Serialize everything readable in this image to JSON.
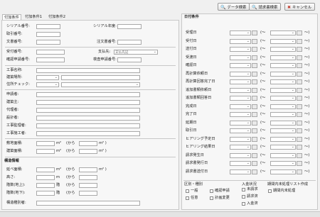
{
  "toolbar": {
    "data_search": "データ検索",
    "request_search": "請求書検索",
    "cancel": "キャンセル"
  },
  "tabs": [
    "付加条件",
    "付加条件1",
    "付加条件2"
  ],
  "left": {
    "serial_no": "シリアル番号:",
    "serial_ver": "シリアル年度:",
    "request_no": "取引番号:",
    "doc_no": "文書番号:",
    "contract_no": "注文書番号:",
    "accept_no": "受付番号:",
    "payment_to": "支払先:",
    "payment_to_placeholder": "支払先記",
    "confirm_no": "確認申請番号:",
    "check_confirm_no": "検査申請番号:",
    "work_name": "工事名称:",
    "building_place": "建築場所:",
    "address_check": "住所チェック:",
    "applicant": "申請者:",
    "builder": "建築主:",
    "agent": "代理者:",
    "designer": "設計者:",
    "supervisor": "工事監理者:",
    "contractor": "工事施工者:",
    "floor_area": "敷地面積:",
    "building_area": "建築面積:",
    "unit_m2": "m²",
    "from": "(から",
    "to_unit": "m²  )",
    "section_building": "構造情報",
    "total_floor": "延べ面積:",
    "height": "高さ:",
    "floors_above": "階数(地上):",
    "floors_below": "階数(地下):",
    "unit_m": "m",
    "unit_floor": "階",
    "remarks": "構造種別者:"
  },
  "right": {
    "section_date": "日付条件",
    "date_rows": [
      "受理日",
      "受付日",
      "送付日",
      "受渡日",
      "確認日",
      "再計算依頼日",
      "再計算回答完了日",
      "追加書類依頼日",
      "追加書類回答日",
      "完成日",
      "完了日",
      "延期日",
      "取引日",
      "ヒアリング予定日",
      "ヒアリング結果日",
      "請求発生日",
      "請求書発行日",
      "請求書送付日"
    ],
    "range_from": "(～",
    "range_to": "～)",
    "section_kubun": "区別・種別",
    "kubun_items": [
      "一般",
      "確認申請",
      "任意",
      "計画変更"
    ],
    "section_input": "入金状況",
    "input_items": [
      "未請求",
      "請求済",
      "入金済"
    ],
    "section_period": "期間内未処理リスト作成",
    "period_items": [
      "期間内未処理"
    ]
  }
}
